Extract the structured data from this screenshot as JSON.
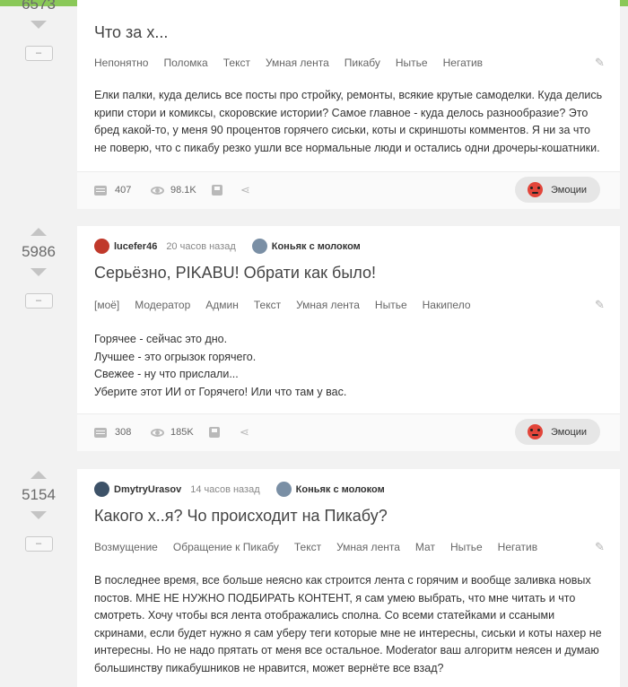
{
  "posts": [
    {
      "rating": "6573",
      "minus_label": "–",
      "title": "Что за х...",
      "tags": [
        "Непонятно",
        "Поломка",
        "Текст",
        "Умная лента",
        "Пикабу",
        "Нытье",
        "Негатив"
      ],
      "body": [
        "Елки палки, куда делись все посты про стройку, ремонты, всякие крутые самоделки. Куда делись крипи стори и комиксы, скоровские истории? Самое главное - куда делось разнообразие? Это бред какой-то, у меня 90 процентов горячего сиськи, коты и скриншоты комментов. Я ни за что не поверю, что с пикабу резко ушли все нормальные люди и остались одни дрочеры-кошатники."
      ],
      "comments": "407",
      "views": "98.1K",
      "emotions_label": "Эмоции"
    },
    {
      "rating": "5986",
      "minus_label": "–",
      "author": "lucefer46",
      "time": "20 часов назад",
      "community": "Коньяк с молоком",
      "title": "Серьёзно, PIKABU! Обрати как было!",
      "tags": [
        "[моё]",
        "Модератор",
        "Админ",
        "Текст",
        "Умная лента",
        "Нытье",
        "Накипело"
      ],
      "body": [
        "Горячее - сейчас это дно.",
        "Лучшее - это огрызок горячего.",
        "Свежее - ну что прислали...",
        "Уберите этот ИИ от Горячего! Или что там у вас."
      ],
      "comments": "308",
      "views": "185K",
      "emotions_label": "Эмоции"
    },
    {
      "rating": "5154",
      "minus_label": "–",
      "author": "DmytryUrasov",
      "time": "14 часов назад",
      "community": "Коньяк с молоком",
      "title": "Какого х..я? Чо происходит на Пикабу?",
      "tags": [
        "Возмущение",
        "Обращение к Пикабу",
        "Текст",
        "Умная лента",
        "Мат",
        "Нытье",
        "Негатив"
      ],
      "body": [
        "В последнее время, все больше неясно как строится лента с горячим и вообще заливка новых постов. МНЕ НЕ НУЖНО ПОДБИРАТЬ КОНТЕНТ, я сам умею выбрать, что мне читать и что смотреть. Хочу чтобы вся лента отображались сполна. Со всеми статейками и ссаными скринами, если будет нужно я сам уберу теги которые мне не интересны, сиськи и коты нахер не интересны. Но не надо прятать от меня все остальное. Moderator ваш алгоритм неясен и думаю большинству пикабушников не нравится, может вернёте все взад?"
      ]
    }
  ],
  "colors": {
    "accent": "#8ac858",
    "background": "#f2f2f2",
    "card": "#ffffff",
    "emotion_face": "#e2453a"
  },
  "icons": [
    "arrow-up-icon",
    "arrow-down-icon",
    "pencil-icon",
    "comment-icon",
    "eye-icon",
    "save-icon",
    "share-icon",
    "angry-face-icon"
  ]
}
